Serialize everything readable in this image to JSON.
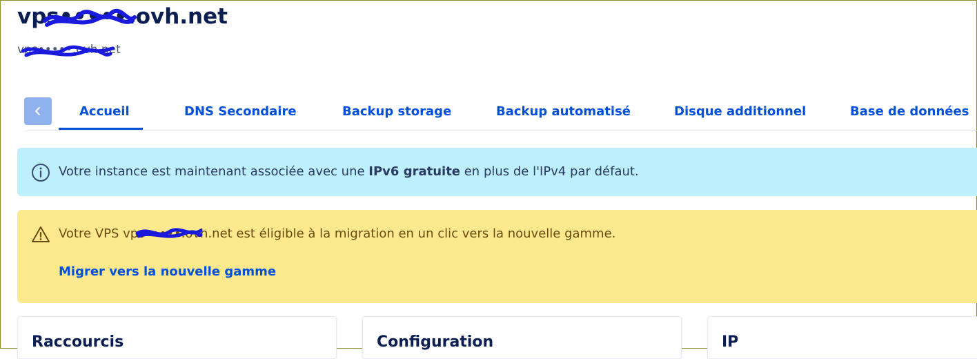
{
  "header": {
    "title": "vps•••••.ovh.net",
    "subtitle": "vps•••••.ovh.net"
  },
  "tabs": [
    {
      "label": "Accueil",
      "active": true
    },
    {
      "label": "DNS Secondaire",
      "active": false
    },
    {
      "label": "Backup storage",
      "active": false
    },
    {
      "label": "Backup automatisé",
      "active": false
    },
    {
      "label": "Disque additionnel",
      "active": false
    },
    {
      "label": "Base de données",
      "active": false
    }
  ],
  "info_banner": {
    "icon": "info-circle-icon",
    "text_before": "Votre instance est maintenant associée avec une ",
    "text_bold": "IPv6 gratuite",
    "text_after": " en plus de l'IPv4 par défaut."
  },
  "warning_banner": {
    "icon": "warning-triangle-icon",
    "text": "Votre VPS vps•••••.ovh.net est éligible à la migration en un clic vers la nouvelle gamme.",
    "link": "Migrer vers la nouvelle gamme"
  },
  "cards": [
    {
      "title": "Raccourcis"
    },
    {
      "title": "Configuration"
    },
    {
      "title": "IP"
    }
  ],
  "colors": {
    "accent": "#0050d7",
    "info_bg": "#bdeffd",
    "warning_bg": "#fce88d",
    "redaction": "#1a1adf"
  }
}
